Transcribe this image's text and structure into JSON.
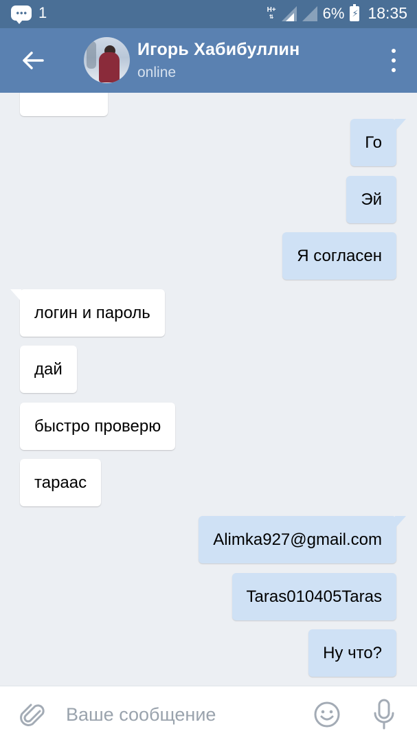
{
  "status_bar": {
    "notification_count": "1",
    "network_type": "H+",
    "battery_percent": "6%",
    "time": "18:35"
  },
  "header": {
    "contact_name": "Игорь Хабибуллин",
    "contact_status": "online"
  },
  "messages": [
    {
      "direction": "incoming",
      "text": ""
    },
    {
      "direction": "outgoing",
      "text": "Го"
    },
    {
      "direction": "outgoing",
      "text": "Эй"
    },
    {
      "direction": "outgoing",
      "text": "Я согласен"
    },
    {
      "direction": "incoming",
      "text": "логин и пароль"
    },
    {
      "direction": "incoming",
      "text": "дай"
    },
    {
      "direction": "incoming",
      "text": "быстро проверю"
    },
    {
      "direction": "incoming",
      "text": "тараас"
    },
    {
      "direction": "outgoing",
      "text": "Alimka927@gmail.com"
    },
    {
      "direction": "outgoing",
      "text": "Taras010405Taras"
    },
    {
      "direction": "outgoing",
      "text": "Ну что?"
    }
  ],
  "composer": {
    "placeholder": "Ваше сообщение"
  },
  "icons": {
    "back": "arrow-left-icon",
    "menu": "more-vertical-icon",
    "attach": "paperclip-icon",
    "emoji": "smiley-icon",
    "mic": "microphone-icon"
  },
  "colors": {
    "status_bar": "#4a6f96",
    "header": "#5a81b1",
    "background": "#eceff3",
    "outgoing_bubble": "#cfe1f5",
    "incoming_bubble": "#ffffff"
  }
}
